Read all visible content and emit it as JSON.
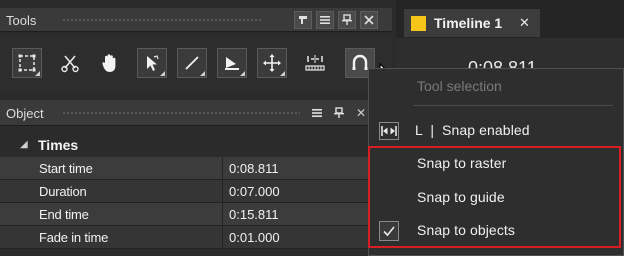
{
  "tools_panel": {
    "title": "Tools",
    "buttons": [
      "pin-config-icon",
      "menu-icon",
      "pin-icon",
      "close-icon"
    ],
    "tools": [
      "selection-rectangle-icon",
      "cut-icon",
      "hand-icon",
      "arrow-select-icon",
      "line-icon",
      "fill-icon",
      "move-icon",
      "split-icon",
      "snap-icon"
    ]
  },
  "timeline_tab": {
    "label": "Timeline 1",
    "close": "✕",
    "accent_color": "#f5c518",
    "time_display": "0:08.811"
  },
  "object_panel": {
    "title": "Object",
    "group": "Times",
    "rows": [
      {
        "key": "Start time",
        "value": "0:08.811"
      },
      {
        "key": "Duration",
        "value": "0:07.000"
      },
      {
        "key": "End time",
        "value": "0:15.811"
      },
      {
        "key": "Fade in time",
        "value": "0:01.000"
      }
    ]
  },
  "context_menu": {
    "header": "Tool selection",
    "items": [
      {
        "label": "L  |  Snap enabled",
        "icon": "snap-toggle-icon",
        "checked": false
      },
      {
        "label": "Snap to raster",
        "checked": false
      },
      {
        "label": "Snap to guide",
        "checked": false
      },
      {
        "label": "Snap to objects",
        "checked": true
      }
    ],
    "highlight_color": "#d61e24"
  }
}
